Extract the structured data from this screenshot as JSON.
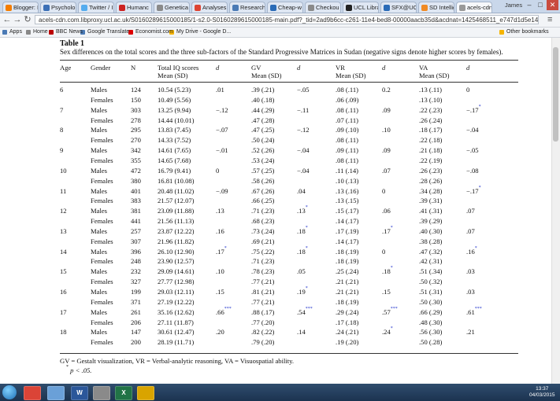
{
  "browser": {
    "tabs": [
      {
        "label": "Blogger: I",
        "color": "#f57d00"
      },
      {
        "label": "Psycholo",
        "color": "#3b6fb6"
      },
      {
        "label": "Twitter / I",
        "color": "#55acee"
      },
      {
        "label": "Humanc",
        "color": "#cc2222"
      },
      {
        "label": "Genetica",
        "color": "#8a8a8a"
      },
      {
        "label": "Analyses",
        "color": "#d43"
      },
      {
        "label": "Research",
        "color": "#4a7ab5"
      },
      {
        "label": "Cheap-w",
        "color": "#2a6bb7"
      },
      {
        "label": "Checkou",
        "color": "#8a8a8a"
      },
      {
        "label": "UCL Libra",
        "color": "#222"
      },
      {
        "label": "SFX@UCI",
        "color": "#2a6bb7"
      },
      {
        "label": "SD Intelligen",
        "color": "#f08a24"
      },
      {
        "label": "acels-cdn",
        "color": "#999"
      }
    ],
    "user_name": "James",
    "url": "acels-cdn.com.libproxy.ucl.ac.uk/S0160289615000185/1-s2.0-S0160289615000185-main.pdf?_tid=2ad9b6cc-c261-11e4-bed8-00000aacb35d&acdnat=1425468511_e747d1d5e14cf339be752a",
    "bookmarks": [
      {
        "label": "Apps",
        "color": "#4a7ab5"
      },
      {
        "label": "Home",
        "color": "#888"
      },
      {
        "label": "BBC News",
        "color": "#b00"
      },
      {
        "label": "Google Translate",
        "color": "#4a7ab5"
      },
      {
        "label": "Economist.com",
        "color": "#d00"
      },
      {
        "label": "My Drive - Google D...",
        "color": "#f5b400"
      }
    ],
    "other_bookmarks": "Other bookmarks"
  },
  "pdf": {
    "table_title": "Table 1",
    "caption": "Sex differences on the total scores and the three sub-factors of the Standard Progressive Matrices in Sudan (negative signs denote higher scores by females).",
    "headers": {
      "age": "Age",
      "gender": "Gender",
      "n": "N",
      "total_line1": "Total IQ scores",
      "total_line2": "Mean (SD)",
      "d1": "d",
      "gv_line1": "GV",
      "gv_line2": "Mean (SD)",
      "d2": "d",
      "vr_line1": "VR",
      "vr_line2": "Mean (SD)",
      "d3": "d",
      "va_line1": "VA",
      "va_line2": "Mean (SD)",
      "d4": "d"
    },
    "groups": [
      {
        "age": "6",
        "male": {
          "label": "Males",
          "n": "124",
          "total": "10.54 (5.23)",
          "gv": ".39 (.21)",
          "vr": ".08 (.11)",
          "va": ".13 (.11)"
        },
        "female": {
          "label": "Females",
          "n": "150",
          "total": "10.49 (5.56)",
          "gv": ".40 (.18)",
          "vr": ".06 (.09)",
          "va": ".13 (.10)"
        },
        "d_total": ".01",
        "d_total_sig": "",
        "d_gv": "−.05",
        "d_gv_sig": "",
        "d_vr": "0.2",
        "d_vr_sig": "",
        "d_va": "0",
        "d_va_sig": ""
      },
      {
        "age": "7",
        "male": {
          "label": "Males",
          "n": "303",
          "total": "13.25 (9.94)",
          "gv": ".44 (.29)",
          "vr": ".08 (.11)",
          "va": ".22 (.23)"
        },
        "female": {
          "label": "Females",
          "n": "278",
          "total": "14.44 (10.01)",
          "gv": ".47 (.28)",
          "vr": ".07 (.11)",
          "va": ".26 (.24)"
        },
        "d_total": "−.12",
        "d_total_sig": "",
        "d_gv": "−.11",
        "d_gv_sig": "",
        "d_vr": ".09",
        "d_vr_sig": "",
        "d_va": "−.17",
        "d_va_sig": "*"
      },
      {
        "age": "8",
        "male": {
          "label": "Males",
          "n": "295",
          "total": "13.83 (7.45)",
          "gv": ".47 (.25)",
          "vr": ".09 (.10)",
          "va": ".18 (.17)"
        },
        "female": {
          "label": "Females",
          "n": "270",
          "total": "14.33 (7.52)",
          "gv": ".50 (.24)",
          "vr": ".08 (.11)",
          "va": ".22 (.18)"
        },
        "d_total": "−.07",
        "d_total_sig": "",
        "d_gv": "−.12",
        "d_gv_sig": "",
        "d_vr": ".10",
        "d_vr_sig": "",
        "d_va": "−.04",
        "d_va_sig": ""
      },
      {
        "age": "9",
        "male": {
          "label": "Males",
          "n": "342",
          "total": "14.61 (7.65)",
          "gv": ".52 (.26)",
          "vr": ".09 (.11)",
          "va": ".21 (.18)"
        },
        "female": {
          "label": "Females",
          "n": "355",
          "total": "14.65 (7.68)",
          "gv": ".53 (.24)",
          "vr": ".08 (.11)",
          "va": ".22 (.19)"
        },
        "d_total": "−.01",
        "d_total_sig": "",
        "d_gv": "−.04",
        "d_gv_sig": "",
        "d_vr": ".09",
        "d_vr_sig": "",
        "d_va": "−.05",
        "d_va_sig": ""
      },
      {
        "age": "10",
        "male": {
          "label": "Males",
          "n": "472",
          "total": "16.79 (9.41)",
          "gv": ".57 (.25)",
          "vr": ".11 (.14)",
          "va": ".26 (.23)"
        },
        "female": {
          "label": "Females",
          "n": "380",
          "total": "16.81 (10.08)",
          "gv": ".58 (.26)",
          "vr": ".10 (.13)",
          "va": ".28 (.26)"
        },
        "d_total": "0",
        "d_total_sig": "",
        "d_gv": "−.04",
        "d_gv_sig": "",
        "d_vr": ".07",
        "d_vr_sig": "",
        "d_va": "−.08",
        "d_va_sig": ""
      },
      {
        "age": "11",
        "male": {
          "label": "Males",
          "n": "401",
          "total": "20.48 (11.02)",
          "gv": ".67 (.26)",
          "vr": ".13 (.16)",
          "va": ".34 (.28)"
        },
        "female": {
          "label": "Females",
          "n": "383",
          "total": "21.57 (12.07)",
          "gv": ".66 (.25)",
          "vr": ".13 (.15)",
          "va": ".39 (.31)"
        },
        "d_total": "−.09",
        "d_total_sig": "",
        "d_gv": ".04",
        "d_gv_sig": "",
        "d_vr": "0",
        "d_vr_sig": "",
        "d_va": "−.17",
        "d_va_sig": "*"
      },
      {
        "age": "12",
        "male": {
          "label": "Males",
          "n": "381",
          "total": "23.09 (11.88)",
          "gv": ".71 (.23)",
          "vr": ".15 (.17)",
          "va": ".41 (.31)"
        },
        "female": {
          "label": "Females",
          "n": "441",
          "total": "21.56 (11.13)",
          "gv": ".68 (.23)",
          "vr": ".14 (.17)",
          "va": ".39 (.29)"
        },
        "d_total": ".13",
        "d_total_sig": "",
        "d_gv": ".13",
        "d_gv_sig": "*",
        "d_vr": ".06",
        "d_vr_sig": "",
        "d_va": ".07",
        "d_va_sig": ""
      },
      {
        "age": "13",
        "male": {
          "label": "Males",
          "n": "257",
          "total": "23.87 (12.22)",
          "gv": ".73 (.24)",
          "vr": ".17 (.19)",
          "va": ".40 (.30)"
        },
        "female": {
          "label": "Females",
          "n": "307",
          "total": "21.96 (11.82)",
          "gv": ".69 (.21)",
          "vr": ".14 (.17)",
          "va": ".38 (.28)"
        },
        "d_total": ".16",
        "d_total_sig": "",
        "d_gv": ".18",
        "d_gv_sig": "*",
        "d_vr": ".17",
        "d_vr_sig": "*",
        "d_va": ".07",
        "d_va_sig": ""
      },
      {
        "age": "14",
        "male": {
          "label": "Males",
          "n": "396",
          "total": "26.10 (12.90)",
          "gv": ".75 (.22)",
          "vr": ".18 (.19)",
          "va": ".47 (.32)"
        },
        "female": {
          "label": "Females",
          "n": "248",
          "total": "23.90 (12.57)",
          "gv": ".71 (.23)",
          "vr": ".18 (.19)",
          "va": ".42 (.31)"
        },
        "d_total": ".17",
        "d_total_sig": "*",
        "d_gv": ".18",
        "d_gv_sig": "*",
        "d_vr": "0",
        "d_vr_sig": "",
        "d_va": ".16",
        "d_va_sig": "*"
      },
      {
        "age": "15",
        "male": {
          "label": "Males",
          "n": "232",
          "total": "29.09 (14.61)",
          "gv": ".78 (.23)",
          "vr": ".25 (.24)",
          "va": ".51 (.34)"
        },
        "female": {
          "label": "Females",
          "n": "327",
          "total": "27.77 (12.98)",
          "gv": ".77 (.21)",
          "vr": ".21 (.21)",
          "va": ".50 (.32)"
        },
        "d_total": ".10",
        "d_total_sig": "",
        "d_gv": ".05",
        "d_gv_sig": "",
        "d_vr": ".18",
        "d_vr_sig": "*",
        "d_va": ".03",
        "d_va_sig": ""
      },
      {
        "age": "16",
        "male": {
          "label": "Males",
          "n": "199",
          "total": "29.03 (12.11)",
          "gv": ".81 (.21)",
          "vr": ".21 (.21)",
          "va": ".51 (.31)"
        },
        "female": {
          "label": "Females",
          "n": "371",
          "total": "27.19 (12.22)",
          "gv": ".77 (.21)",
          "vr": ".18 (.19)",
          "va": ".50 (.30)"
        },
        "d_total": ".15",
        "d_total_sig": "",
        "d_gv": ".19",
        "d_gv_sig": "*",
        "d_vr": ".15",
        "d_vr_sig": "",
        "d_va": ".03",
        "d_va_sig": ""
      },
      {
        "age": "17",
        "male": {
          "label": "Males",
          "n": "261",
          "total": "35.16 (12.62)",
          "gv": ".88 (.17)",
          "vr": ".29 (.24)",
          "va": ".66 (.29)"
        },
        "female": {
          "label": "Females",
          "n": "206",
          "total": "27.11 (11.87)",
          "gv": ".77 (.20)",
          "vr": ".17 (.18)",
          "va": ".48 (.30)"
        },
        "d_total": ".66",
        "d_total_sig": "***",
        "d_gv": ".54",
        "d_gv_sig": "***",
        "d_vr": ".57",
        "d_vr_sig": "***",
        "d_va": ".61",
        "d_va_sig": "***"
      },
      {
        "age": "18",
        "male": {
          "label": "Males",
          "n": "147",
          "total": "30.61 (12.47)",
          "gv": ".82 (.22)",
          "vr": ".24 (.21)",
          "va": ".56 (.30)"
        },
        "female": {
          "label": "Females",
          "n": "200",
          "total": "28.19 (11.71)",
          "gv": ".79 (.20)",
          "vr": ".19 (.20)",
          "va": ".50 (.28)"
        },
        "d_total": ".20",
        "d_total_sig": "",
        "d_gv": ".14",
        "d_gv_sig": "",
        "d_vr": ".24",
        "d_vr_sig": "*",
        "d_va": ".21",
        "d_va_sig": ""
      }
    ],
    "footnote1": "GV = Gestalt visualization, VR = Verbal-analytic reasoning, VA = Visuospatial ability.",
    "footnote2_star": "*",
    "footnote2": "p < .05."
  },
  "taskbar": {
    "apps": [
      {
        "label": "",
        "color": "#db4437"
      },
      {
        "label": "",
        "color": "#6aa0d8"
      },
      {
        "label": "W",
        "color": "#2b579a"
      },
      {
        "label": "",
        "color": "#8a8a8a"
      },
      {
        "label": "X",
        "color": "#217346"
      },
      {
        "label": "",
        "color": "#d9a400"
      }
    ],
    "time": "13:37",
    "date": "04/03/2015"
  }
}
